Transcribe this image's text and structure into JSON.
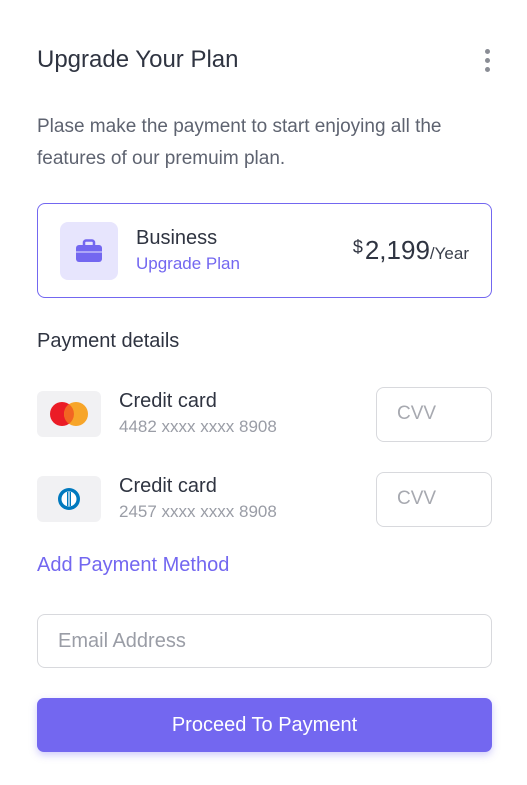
{
  "header": {
    "title": "Upgrade Your Plan",
    "menu_icon": "more-vertical-icon"
  },
  "description": "Plase make the payment to start enjoying all the features of our premuim plan.",
  "plan": {
    "icon": "briefcase-icon",
    "name": "Business",
    "link_label": "Upgrade Plan",
    "currency": "$",
    "amount": "2,199",
    "period": "/Year"
  },
  "payment": {
    "section_title": "Payment details",
    "methods": [
      {
        "brand_icon": "mastercard-icon",
        "name": "Credit card",
        "number": "4482 xxxx xxxx 8908",
        "cvv_placeholder": "CVV"
      },
      {
        "brand_icon": "diners-club-icon",
        "name": "Credit card",
        "number": "2457 xxxx xxxx 8908",
        "cvv_placeholder": "CVV"
      }
    ],
    "add_method_label": "Add Payment Method"
  },
  "email": {
    "placeholder": "Email Address",
    "value": ""
  },
  "proceed_label": "Proceed To Payment",
  "colors": {
    "accent": "#7367f0",
    "accent_light": "#e7e5fd",
    "text": "#2f3441",
    "muted": "#9a9da6",
    "border": "#d8d9dd"
  }
}
